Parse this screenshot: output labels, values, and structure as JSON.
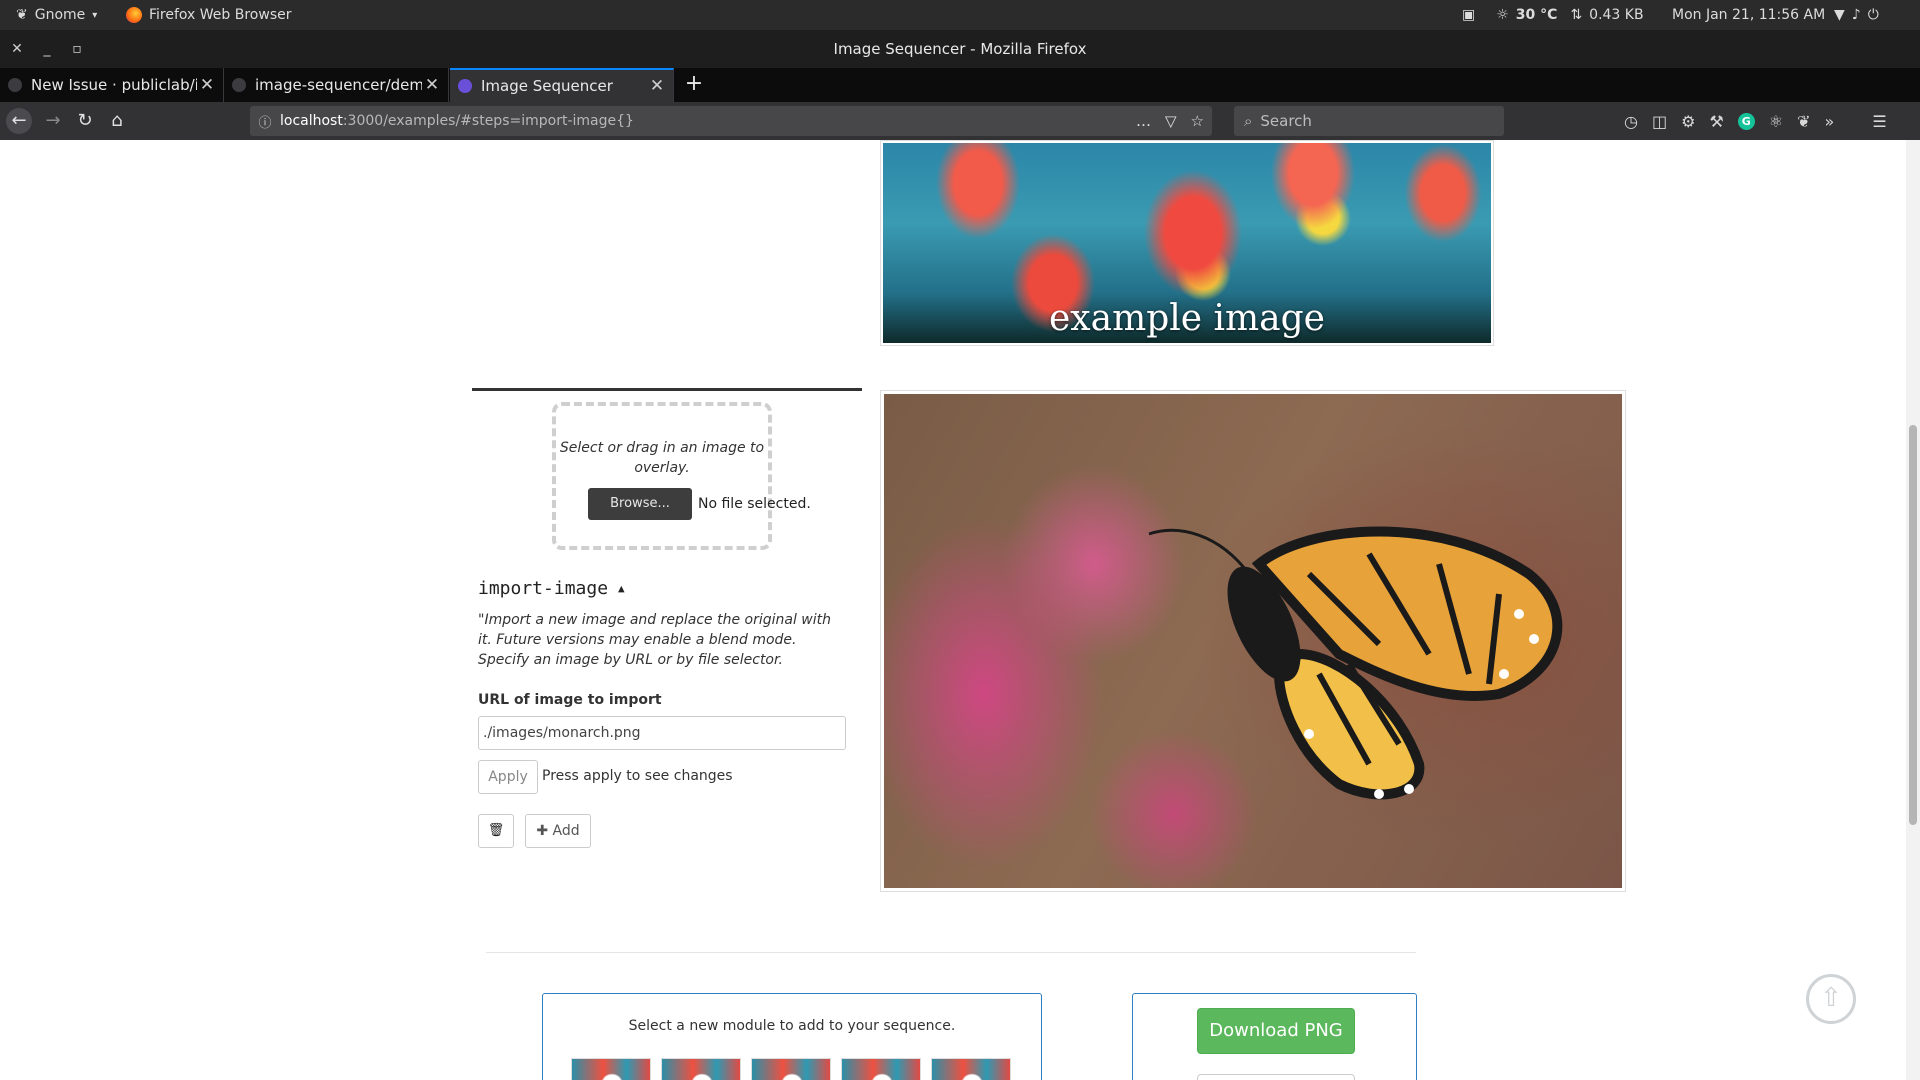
{
  "gnome": {
    "activities_label": "Gnome",
    "app_label": "Firefox Web Browser",
    "weather": "30 °C",
    "network_rate": "0.43 KB",
    "clock": "Mon Jan 21, 11:56 AM"
  },
  "window": {
    "title": "Image Sequencer - Mozilla Firefox"
  },
  "tabs": [
    {
      "label": "New Issue · publiclab/ima"
    },
    {
      "label": "image-sequencer/demo.c"
    },
    {
      "label": "Image Sequencer"
    }
  ],
  "nav": {
    "url_host": "localhost",
    "url_path": ":3000/examples/#steps=import-image{}",
    "search_placeholder": "Search"
  },
  "prev_step": {
    "caption": "example image"
  },
  "step": {
    "dropzone_text": "Select or drag in an image to overlay.",
    "browse_label": "Browse...",
    "file_status": "No file selected.",
    "title": "import-image",
    "description": "\"Import a new image and replace the original with it. Future versions may enable a blend mode. Specify an image by URL or by file selector.",
    "url_label": "URL of image to import",
    "url_value": "./images/monarch.png",
    "apply_label": "Apply",
    "apply_hint": "Press apply to see changes",
    "add_label": "Add"
  },
  "modules": {
    "prompt": "Select a new module to add to your sequence."
  },
  "download": {
    "label": "Download PNG"
  },
  "colors": {
    "accent_tab": "#0a84ff",
    "download_green": "#5cb85c",
    "panel_border": "#2f7fc0"
  },
  "icons": {
    "topbar": [
      "gnome-foot-icon",
      "firefox-icon",
      "clipboard-icon",
      "sun-icon",
      "network-icon",
      "wifi-icon",
      "volume-icon",
      "power-icon"
    ],
    "toolbar": [
      "history-icon",
      "sidebar-icon",
      "extension-gear-icon",
      "devtools-wrench-icon",
      "grammarly-icon",
      "react-icon",
      "bird-icon",
      "overflow-icon",
      "hamburger-menu-icon"
    ]
  }
}
